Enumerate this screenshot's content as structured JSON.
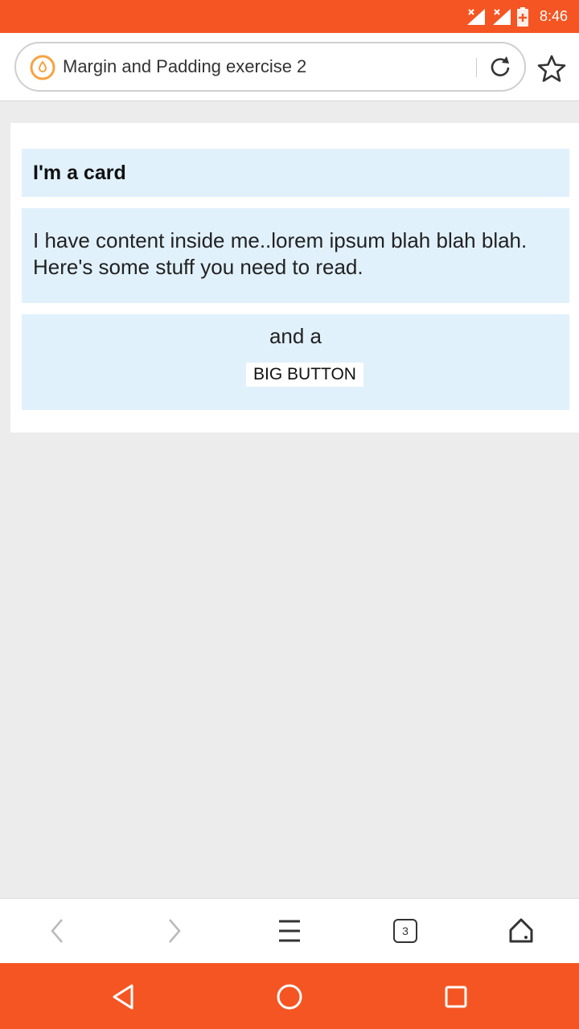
{
  "status_bar": {
    "time": "8:46",
    "icons": [
      "signal-x-icon",
      "signal-x-icon",
      "battery-charging-icon"
    ]
  },
  "browser": {
    "site_icon": "droplet-logo-icon",
    "page_title": "Margin and Padding exercise 2",
    "reload_icon": "reload-icon",
    "bookmark_icon": "star-icon"
  },
  "card": {
    "header": "I'm a card",
    "body": "I have content inside me..lorem ipsum blah blah blah. Here's some stuff you need to read.",
    "footer_text": "and a",
    "button_label": "BIG BUTTON"
  },
  "bottom_nav": {
    "items": [
      "back-icon",
      "forward-icon",
      "menu-icon",
      "tabs-icon",
      "home-icon"
    ],
    "tab_count": "3"
  },
  "system_nav": {
    "items": [
      "back-triangle-icon",
      "home-circle-icon",
      "recents-square-icon"
    ]
  },
  "colors": {
    "accent": "#f55522",
    "card_section_bg": "#e1f1fc",
    "page_bg": "#ececec"
  }
}
